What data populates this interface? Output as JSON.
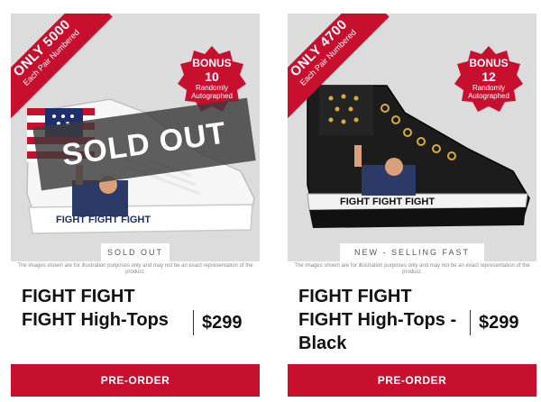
{
  "products": [
    {
      "ribbon_big": "ONLY 5000",
      "ribbon_small": "Each Pair Numbered",
      "seal_line1": "BONUS",
      "seal_line2": "10",
      "seal_line3": "Randomly Autographed",
      "overlay": "SOLD OUT",
      "shoe_text": "FIGHT FIGHT FIGHT",
      "status_tag": "SOLD OUT",
      "disclaimer": "The images shown are for illustration purposes only and may not be an exact representation of the product.",
      "title": "FIGHT FIGHT FIGHT High-Tops",
      "price": "$299",
      "button": "PRE-ORDER",
      "shoe_color": "white"
    },
    {
      "ribbon_big": "ONLY 4700",
      "ribbon_small": "Each Pair Numbered",
      "seal_line1": "BONUS",
      "seal_line2": "12",
      "seal_line3": "Randomly Autographed",
      "shoe_text": "FIGHT FIGHT FIGHT",
      "status_tag": "NEW - SELLING FAST",
      "disclaimer": "The images shown are for illustration purposes only and may not be an exact representation of the product.",
      "title": "FIGHT FIGHT FIGHT High-Tops - Black",
      "price": "$299",
      "button": "PRE-ORDER",
      "shoe_color": "black"
    }
  ],
  "colors": {
    "accent": "#c8102e",
    "image_bg": "#dcdcdc"
  }
}
